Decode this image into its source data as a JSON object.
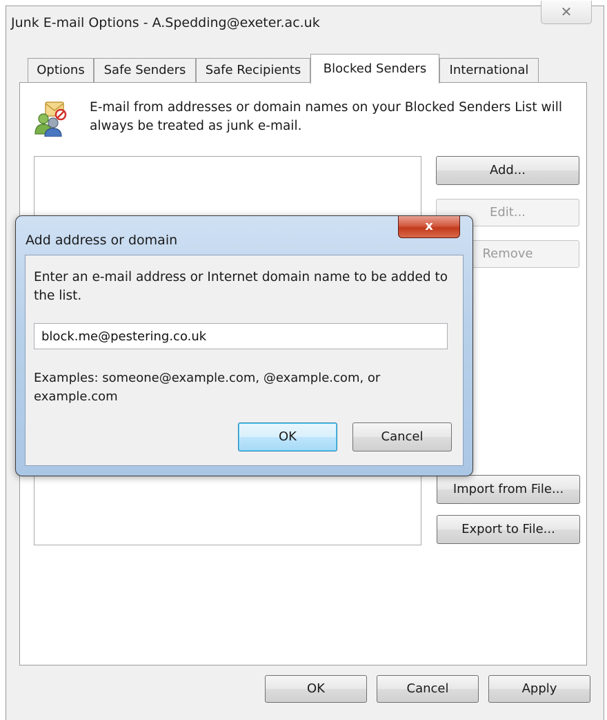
{
  "window": {
    "title": "Junk E-mail Options - A.Spedding@exeter.ac.uk",
    "close_glyph": "✕"
  },
  "tabs": [
    {
      "label": "Options"
    },
    {
      "label": "Safe Senders"
    },
    {
      "label": "Safe Recipients"
    },
    {
      "label": "Blocked Senders"
    },
    {
      "label": "International"
    }
  ],
  "active_tab": "Blocked Senders",
  "blocked": {
    "info": "E-mail from addresses or domain names on your Blocked Senders List will always be treated as junk e-mail.",
    "icon": "people-icon",
    "buttons": {
      "add": "Add...",
      "edit": "Edit...",
      "remove": "Remove",
      "import": "Import from File...",
      "export": "Export to File..."
    }
  },
  "footer": {
    "ok": "OK",
    "cancel": "Cancel",
    "apply": "Apply"
  },
  "dialog": {
    "title": "Add address or domain",
    "close_glyph": "x",
    "prompt": "Enter an e-mail address or Internet domain name to be added to the list.",
    "input_value": "block.me@pestering.co.uk",
    "examples": "Examples: someone@example.com, @example.com, or example.com",
    "ok": "OK",
    "cancel": "Cancel"
  },
  "colors": {
    "window_bg": "#f0f0f0",
    "dialog_frame": "#b9d1ea",
    "close_red": "#c23a1c",
    "default_button_border": "#3c7fb1"
  }
}
